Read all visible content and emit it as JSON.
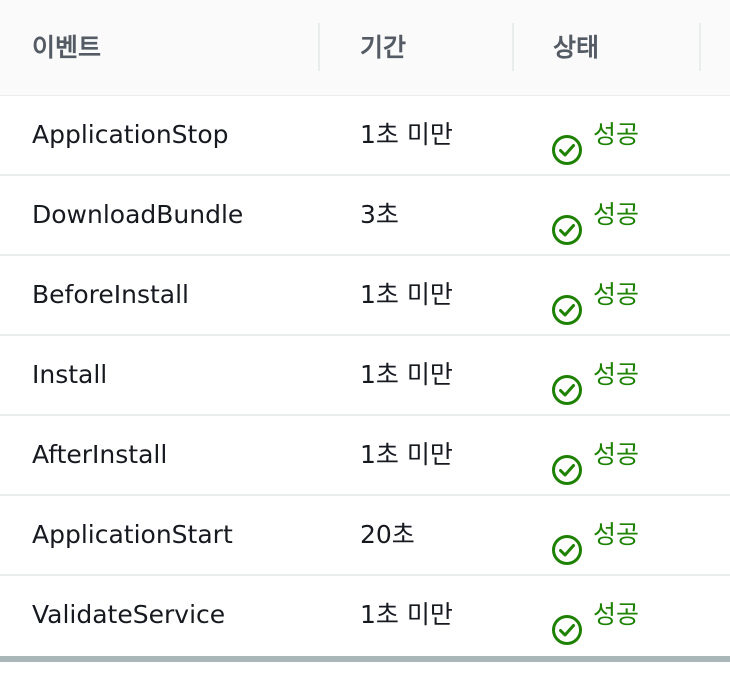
{
  "table": {
    "headers": {
      "event": "이벤트",
      "duration": "기간",
      "status": "상태"
    },
    "rows": [
      {
        "event": "ApplicationStop",
        "duration": "1초 미만",
        "status": "성공"
      },
      {
        "event": "DownloadBundle",
        "duration": "3초",
        "status": "성공"
      },
      {
        "event": "BeforeInstall",
        "duration": "1초 미만",
        "status": "성공"
      },
      {
        "event": "Install",
        "duration": "1초 미만",
        "status": "성공"
      },
      {
        "event": "AfterInstall",
        "duration": "1초 미만",
        "status": "성공"
      },
      {
        "event": "ApplicationStart",
        "duration": "20초",
        "status": "성공"
      },
      {
        "event": "ValidateService",
        "duration": "1초 미만",
        "status": "성공"
      }
    ]
  },
  "colors": {
    "success": "#1d8102",
    "header_text": "#545b64",
    "body_text": "#16191f"
  },
  "icons": {
    "status": "success-check-circle-icon"
  }
}
